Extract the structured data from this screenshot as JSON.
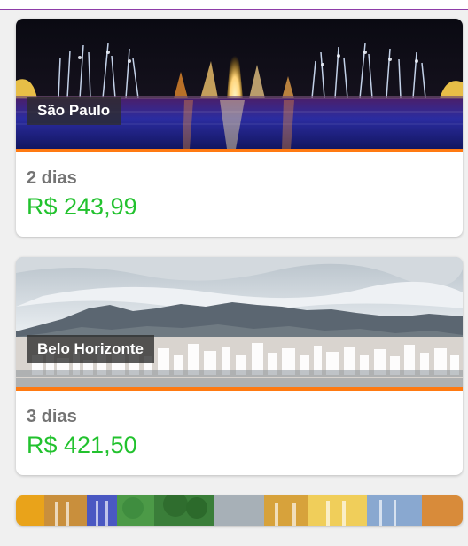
{
  "cards": [
    {
      "city": "São Paulo",
      "duration": "2 dias",
      "price": "R$ 243,99",
      "image_icon": "city-fountain-night-image"
    },
    {
      "city": "Belo Horizonte",
      "duration": "3 dias",
      "price": "R$ 421,50",
      "image_icon": "city-mountain-skyline-image"
    },
    {
      "image_icon": "colorful-buildings-image"
    }
  ],
  "colors": {
    "accent_orange": "#ff7a12",
    "price_green": "#22c22e",
    "top_bar_purple": "#8e3da8"
  }
}
